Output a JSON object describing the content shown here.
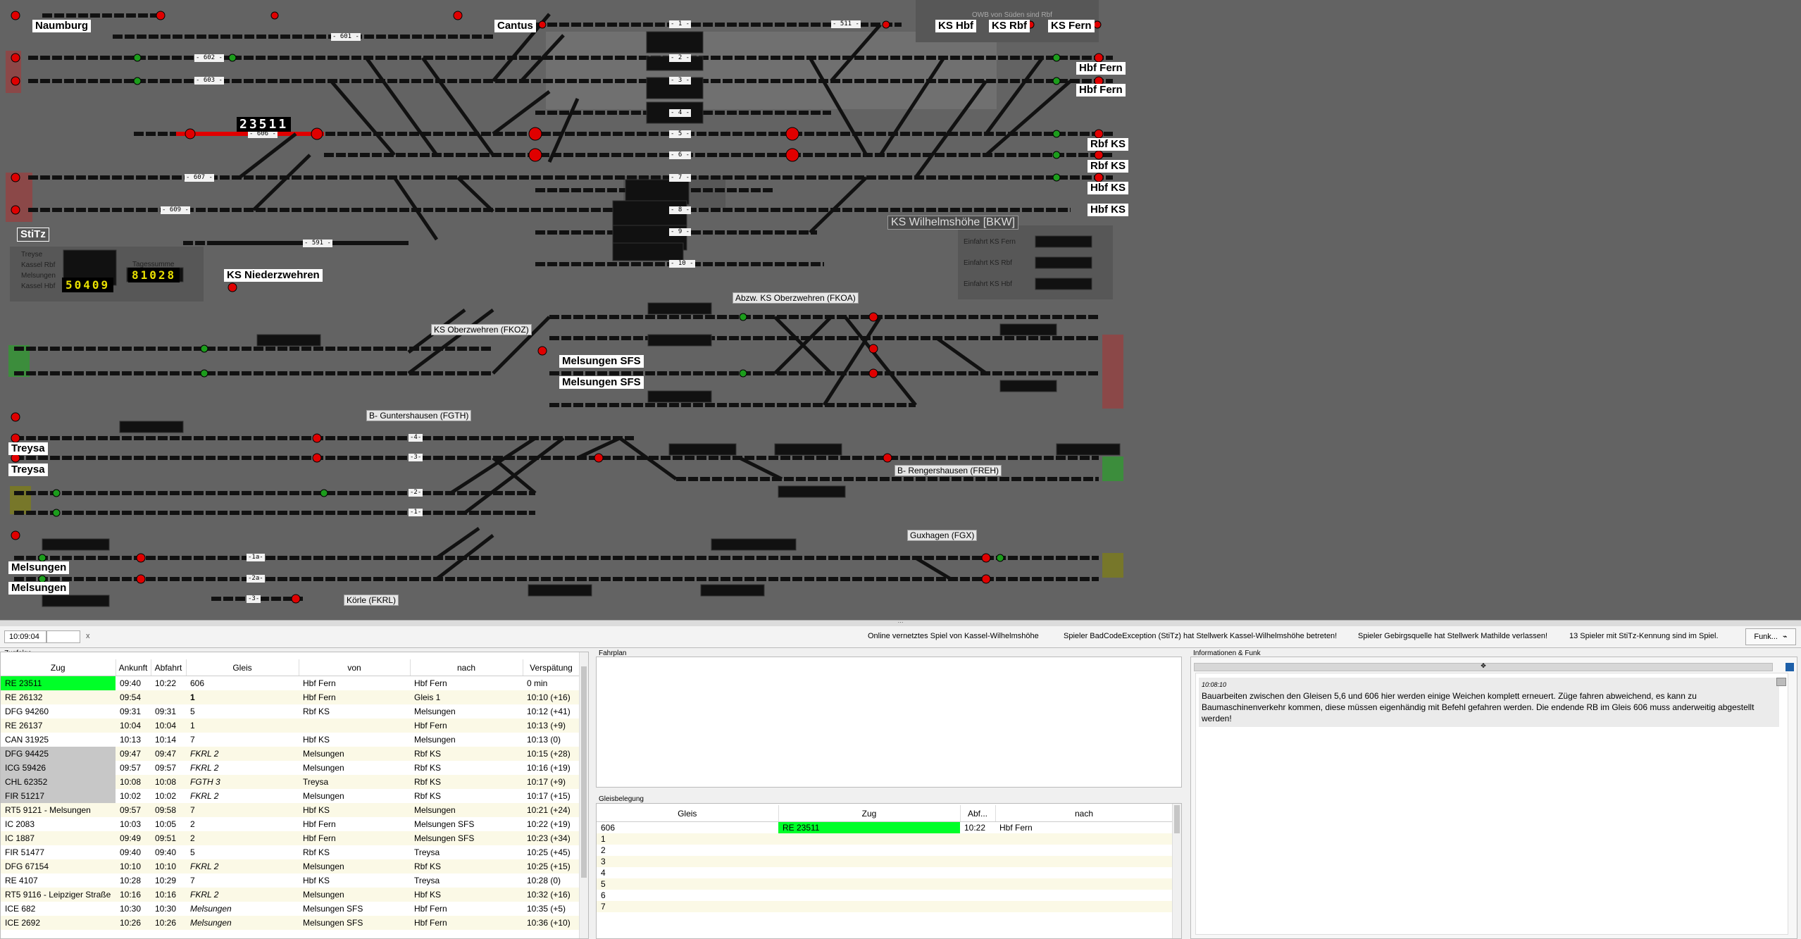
{
  "board": {
    "stations": [
      {
        "name": "Naumburg"
      },
      {
        "name": "Cantus"
      },
      {
        "name": "KS Hbf"
      },
      {
        "name": "KS Rbf"
      },
      {
        "name": "KS Fern"
      },
      {
        "name": "Hbf Fern"
      },
      {
        "name": "Hbf Fern"
      },
      {
        "name": "Rbf KS"
      },
      {
        "name": "Rbf KS"
      },
      {
        "name": "Hbf KS"
      },
      {
        "name": "Hbf KS"
      },
      {
        "name": "StiTz"
      },
      {
        "name": "KS Niederzwehren"
      },
      {
        "name": "Melsungen SFS"
      },
      {
        "name": "Melsungen SFS"
      },
      {
        "name": "Treysa"
      },
      {
        "name": "Treysa"
      },
      {
        "name": "Melsungen"
      },
      {
        "name": "Melsungen"
      }
    ],
    "area_labels": [
      {
        "name": "KS Wilhelmshöhe [BKW]"
      },
      {
        "name": "KS Oberzwehren (FKOZ)"
      },
      {
        "name": "Abzw. KS Oberzwehren (FKOA)"
      },
      {
        "name": "B- Guntershausen (FGTH)"
      },
      {
        "name": "B- Rengershausen (FREH)"
      },
      {
        "name": "Guxhagen (FGX)"
      },
      {
        "name": "Körle (FKRL)"
      }
    ],
    "track_numbers": [
      "- 1 -",
      "- 2 -",
      "- 3 -",
      "- 4 -",
      "- 5 -",
      "- 6 -",
      "- 7 -",
      "- 8 -",
      "- 9 -",
      "- 10 -",
      "- 601 -",
      "- 602 -",
      "- 603 -",
      "- 606 -",
      "- 607 -",
      "- 609 -",
      "- 591 -",
      "- 511 -",
      "-4-",
      "-3-",
      "-2-",
      "-1-",
      "-1a-",
      "-2a-",
      "-3-"
    ],
    "train_number_display": "23511",
    "stats": {
      "labels": [
        "Treyse",
        "Kassel Rbf",
        "Melsungen",
        "Kassel Hbf"
      ],
      "counter": "50409",
      "counter_label": "Tagessumme",
      "counter2": "81028"
    },
    "entry_labels": [
      "Einfahrt KS Fern",
      "Einfahrt KS Rbf",
      "Einfahrt KS Hbf"
    ],
    "top_info": "OWB von Süden sind Rbf"
  },
  "statusbar": {
    "time": "10:09:04",
    "close": "x",
    "messages": [
      "Online vernetztes Spiel von Kassel-Wilhelmshöhe",
      "Spieler BadCodeException (StiTz) hat Stellwerk Kassel-Wilhelmshöhe betreten!",
      "Spieler Gebirgsquelle hat Stellwerk Mathilde verlassen!",
      "13 Spieler mit StiTz-Kennung sind im Spiel."
    ],
    "funk_button": "Funk..."
  },
  "zugfolge": {
    "title": "Zugfolge",
    "columns": [
      "Zug",
      "Ankunft",
      "Abfahrt",
      "Gleis",
      "von",
      "nach",
      "Verspätung"
    ],
    "rows": [
      {
        "zug": "RE 23511",
        "an": "09:40",
        "ab": "10:22",
        "gleis": "606",
        "von": "Hbf Fern",
        "nach": "Hbf Fern",
        "vsp": "0 min",
        "hl": "green"
      },
      {
        "zug": "RE 26132",
        "an": "09:54",
        "ab": "",
        "gleis": "1",
        "von": "Hbf Fern",
        "nach": "Gleis 1",
        "vsp": "10:10 (+16)",
        "hl": ""
      },
      {
        "zug": "DFG 94260",
        "an": "09:31",
        "ab": "09:31",
        "gleis": "5",
        "von": "Rbf KS",
        "nach": "Melsungen",
        "vsp": "10:12 (+41)",
        "hl": ""
      },
      {
        "zug": "RE 26137",
        "an": "10:04",
        "ab": "10:04",
        "gleis": "1",
        "von": "",
        "nach": "Hbf Fern",
        "vsp": "10:13 (+9)",
        "hl": ""
      },
      {
        "zug": "CAN 31925",
        "an": "10:13",
        "ab": "10:14",
        "gleis": "7",
        "von": "Hbf KS",
        "nach": "Melsungen",
        "vsp": "10:13 (0)",
        "hl": ""
      },
      {
        "zug": "DFG 94425",
        "an": "09:47",
        "ab": "09:47",
        "gleis": "FKRL 2",
        "von": "Melsungen",
        "nach": "Rbf KS",
        "vsp": "10:15 (+28)",
        "hl": "grey"
      },
      {
        "zug": "ICG 59426",
        "an": "09:57",
        "ab": "09:57",
        "gleis": "FKRL 2",
        "von": "Melsungen",
        "nach": "Rbf KS",
        "vsp": "10:16 (+19)",
        "hl": "grey"
      },
      {
        "zug": "CHL 62352",
        "an": "10:08",
        "ab": "10:08",
        "gleis": "FGTH 3",
        "von": "Treysa",
        "nach": "Rbf KS",
        "vsp": "10:17 (+9)",
        "hl": "grey"
      },
      {
        "zug": "FIR 51217",
        "an": "10:02",
        "ab": "10:02",
        "gleis": "FKRL 2",
        "von": "Melsungen",
        "nach": "Rbf KS",
        "vsp": "10:17 (+15)",
        "hl": "grey"
      },
      {
        "zug": "RT5 9121 - Melsungen",
        "an": "09:57",
        "ab": "09:58",
        "gleis": "7",
        "von": "Hbf KS",
        "nach": "Melsungen",
        "vsp": "10:21 (+24)",
        "hl": ""
      },
      {
        "zug": "IC 2083",
        "an": "10:03",
        "ab": "10:05",
        "gleis": "2",
        "von": "Hbf Fern",
        "nach": "Melsungen SFS",
        "vsp": "10:22 (+19)",
        "hl": ""
      },
      {
        "zug": "IC 1887",
        "an": "09:49",
        "ab": "09:51",
        "gleis": "2",
        "von": "Hbf Fern",
        "nach": "Melsungen SFS",
        "vsp": "10:23 (+34)",
        "hl": ""
      },
      {
        "zug": "FIR 51477",
        "an": "09:40",
        "ab": "09:40",
        "gleis": "5",
        "von": "Rbf KS",
        "nach": "Treysa",
        "vsp": "10:25 (+45)",
        "hl": ""
      },
      {
        "zug": "DFG 67154",
        "an": "10:10",
        "ab": "10:10",
        "gleis": "FKRL 2",
        "von": "Melsungen",
        "nach": "Rbf KS",
        "vsp": "10:25 (+15)",
        "hl": ""
      },
      {
        "zug": "RE 4107",
        "an": "10:28",
        "ab": "10:29",
        "gleis": "7",
        "von": "Hbf KS",
        "nach": "Treysa",
        "vsp": "10:28 (0)",
        "hl": ""
      },
      {
        "zug": "RT5 9116 - Leipziger Straße",
        "an": "10:16",
        "ab": "10:16",
        "gleis": "FKRL 2",
        "von": "Melsungen",
        "nach": "Hbf KS",
        "vsp": "10:32 (+16)",
        "hl": ""
      },
      {
        "zug": "ICE 682",
        "an": "10:30",
        "ab": "10:30",
        "gleis": "Melsungen",
        "von": "Melsungen SFS",
        "nach": "Hbf Fern",
        "vsp": "10:35 (+5)",
        "hl": ""
      },
      {
        "zug": "ICE 2692",
        "an": "10:26",
        "ab": "10:26",
        "gleis": "Melsungen",
        "von": "Melsungen SFS",
        "nach": "Hbf Fern",
        "vsp": "10:36 (+10)",
        "hl": ""
      }
    ]
  },
  "fahrplan": {
    "title": "Fahrplan"
  },
  "gleisbelegung": {
    "title": "Gleisbelegung",
    "columns": [
      "Gleis",
      "Zug",
      "Abf...",
      "nach"
    ],
    "rows": [
      {
        "gleis": "606",
        "zug": "RE 23511",
        "abf": "10:22",
        "nach": "Hbf Fern"
      },
      {
        "gleis": "1",
        "zug": "",
        "abf": "",
        "nach": ""
      },
      {
        "gleis": "2",
        "zug": "",
        "abf": "",
        "nach": ""
      },
      {
        "gleis": "3",
        "zug": "",
        "abf": "",
        "nach": ""
      },
      {
        "gleis": "4",
        "zug": "",
        "abf": "",
        "nach": ""
      },
      {
        "gleis": "5",
        "zug": "",
        "abf": "",
        "nach": ""
      },
      {
        "gleis": "6",
        "zug": "",
        "abf": "",
        "nach": ""
      },
      {
        "gleis": "7",
        "zug": "",
        "abf": "",
        "nach": ""
      }
    ]
  },
  "info": {
    "title": "Informationen & Funk",
    "time": "10:08:10",
    "message": "Bauarbeiten zwischen den Gleisen 5,6 und 606 hier werden einige Weichen komplett erneuert. Züge fahren abweichend, es kann zu Baumaschinenverkehr kommen, diese müssen eigenhändig mit Befehl gefahren werden. Die endende RB im Gleis 606 muss anderweitig abgestellt werden!"
  }
}
